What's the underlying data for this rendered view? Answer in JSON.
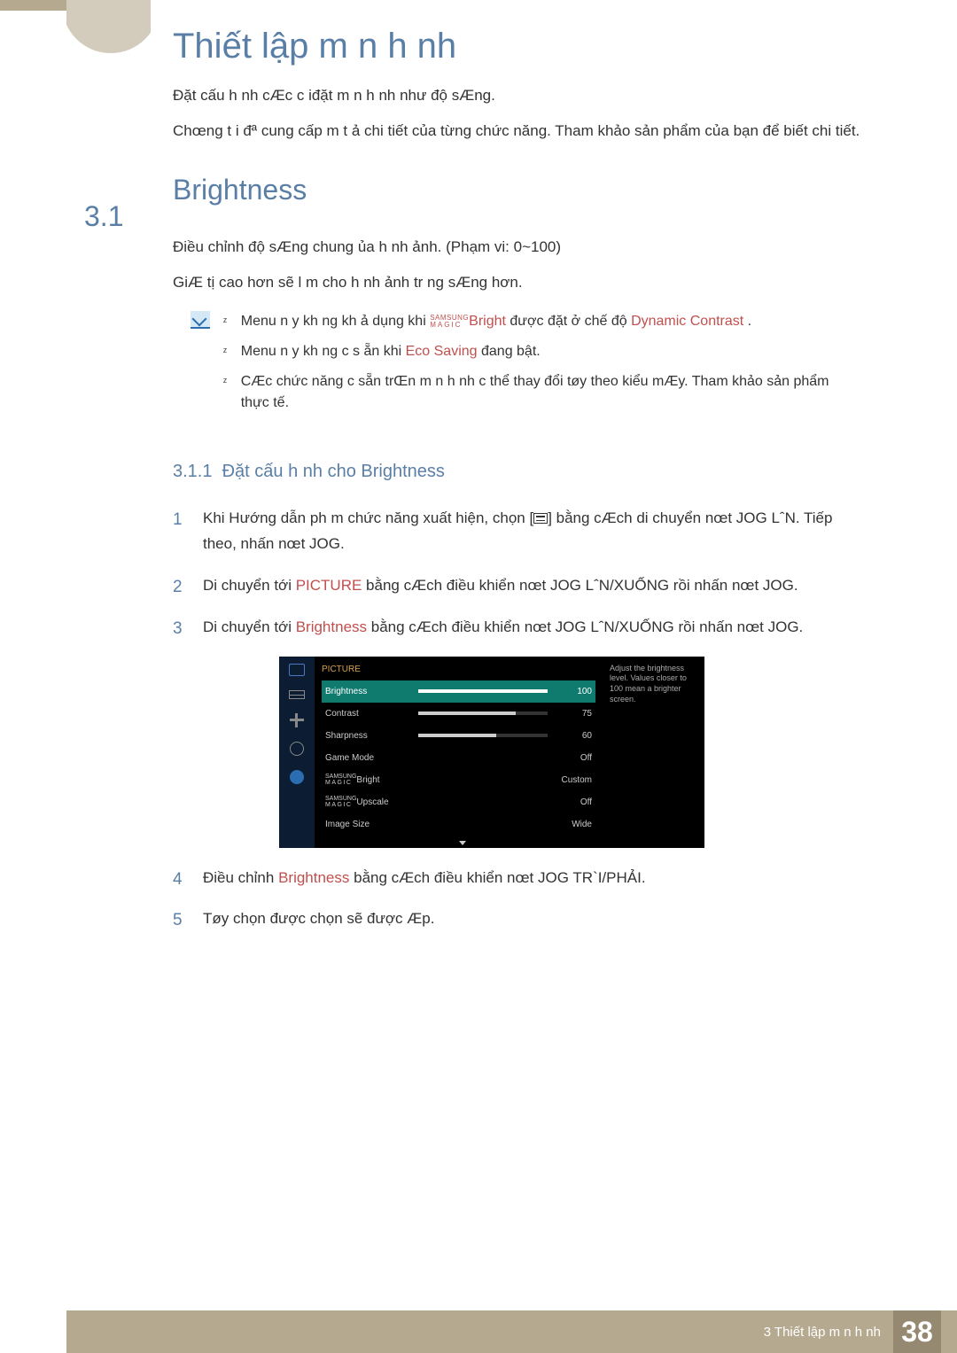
{
  "chapter_title": "Thiết lập m n h nh",
  "intro1": "Đặt cấu h nh cÆc c iđặt m n h nh như độ sÆng.",
  "intro2": "Chœng t i đª cung cấp m  t ả chi tiết của từng chức năng. Tham khảo sản phẩm của bạn để biết chi tiết.",
  "section_num": "3.1",
  "section_title": "Brightness",
  "sec_p1": "Điều chỉnh độ sÆng chung ủa h nh ảnh. (Phạm vi: 0~100)",
  "sec_p2": "GiÆ tị cao hơn sẽ l m cho h nh  ảnh tr ng sÆng hơn.",
  "note1_a": "Menu n y kh ng kh  ả dụng khi ",
  "note1_magic": "Bright",
  "note1_b": "  được đặt ở chế độ ",
  "note1_c": "Dynamic Contrast",
  "note1_d": " .",
  "note2_a": "Menu n y kh ng c  s ẵn khi ",
  "note2_b": "Eco Saving",
  "note2_c": "  đang bật.",
  "note3": "CÆc chức năng c  sẵn trŒn m n h nh c  thể thay đổi tøy theo kiểu mÆy. Tham khảo sản phẩm thực tế.",
  "subsection_num": "3.1.1",
  "subsection_title": "Đặt cấu h nh cho Brightness",
  "step1_a": "Khi Hướng dẫn ph m chức năng xuất hiện, chọn [",
  "step1_b": "] bằng cÆch di chuyển nœt JOG LˆN. Tiếp theo, nhấn nœt JOG.",
  "step2_a": "Di chuyển tới ",
  "step2_b": "PICTURE",
  "step2_c": " bằng cÆch điều khiển nœt JOG LˆN/XUỐNG rồi nhấn nœt JOG.",
  "step3_a": "Di chuyển tới ",
  "step3_b": "Brightness",
  "step3_c": "  bằng cÆch điều khiển nœt JOG LˆN/XUỐNG rồi nhấn nœt JOG.",
  "step4_a": "Điều chỉnh ",
  "step4_b": "Brightness",
  "step4_c": "  bằng cÆch điều khiển nœt JOG TR`I/PHẢI.",
  "step5": "Tøy chọn được chọn sẽ được Æp.",
  "osd": {
    "header": "PICTURE",
    "tip": "Adjust the brightness level. Values closer to 100 mean a brighter screen.",
    "rows": [
      {
        "label": "Brightness",
        "value": "100",
        "bar": 100,
        "selected": true
      },
      {
        "label": "Contrast",
        "value": "75",
        "bar": 75
      },
      {
        "label": "Sharpness",
        "value": "60",
        "bar": 60
      },
      {
        "label": "Game Mode",
        "value": "Off"
      },
      {
        "label": "MAGIC",
        "suffix": "Bright",
        "value": "Custom"
      },
      {
        "label": "MAGIC",
        "suffix": "Upscale",
        "value": "Off"
      },
      {
        "label": "Image Size",
        "value": "Wide"
      }
    ]
  },
  "footer_chapter": "3 Thiết lập m n h nh",
  "footer_page": "38"
}
